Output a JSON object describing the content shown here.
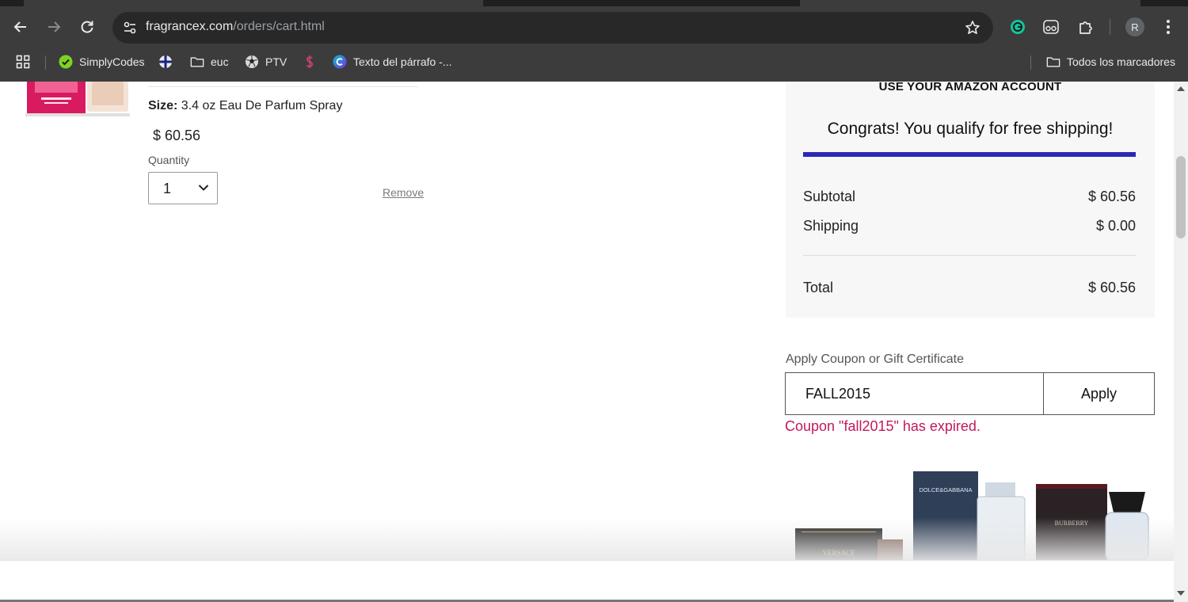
{
  "browser": {
    "url_domain": "fragrancex.com",
    "url_path": "/orders/cart.html",
    "profile_initial": "R",
    "bookmarks": [
      {
        "label": "SimplyCodes",
        "icon": "simplycodes-icon"
      },
      {
        "label": "",
        "icon": "globe-grid-icon"
      },
      {
        "label": "euc",
        "icon": "folder-icon"
      },
      {
        "label": "PTV",
        "icon": "soccer-ball-icon"
      },
      {
        "label": "",
        "icon": "dollar-icon"
      },
      {
        "label": "Texto del párrafo -...",
        "icon": "canva-icon"
      }
    ],
    "all_bookmarks_label": "Todos los marcadores"
  },
  "cart_item": {
    "size_label": "Size:",
    "size_value": "3.4 oz Eau De Parfum Spray",
    "price": "$ 60.56",
    "quantity_label": "Quantity",
    "quantity_value": "1",
    "remove_label": "Remove"
  },
  "summary": {
    "amazon_label": "USE YOUR AMAZON ACCOUNT",
    "free_shipping_message": "Congrats! You qualify for free shipping!",
    "free_shipping_progress": 1.0,
    "progress_color": "#2a2ab4",
    "subtotal_label": "Subtotal",
    "subtotal_value": "$ 60.56",
    "shipping_label": "Shipping",
    "shipping_value": "$ 0.00",
    "total_label": "Total",
    "total_value": "$ 60.56"
  },
  "coupon": {
    "title": "Apply Coupon or Gift Certificate",
    "input_value": "FALL2015",
    "apply_label": "Apply",
    "error_message": "Coupon \"fall2015\" has expired.",
    "error_color": "#c2185b"
  },
  "promo": {
    "brands": [
      "VERSACE",
      "DOLCE&GABBANA",
      "BURBERRY"
    ]
  }
}
